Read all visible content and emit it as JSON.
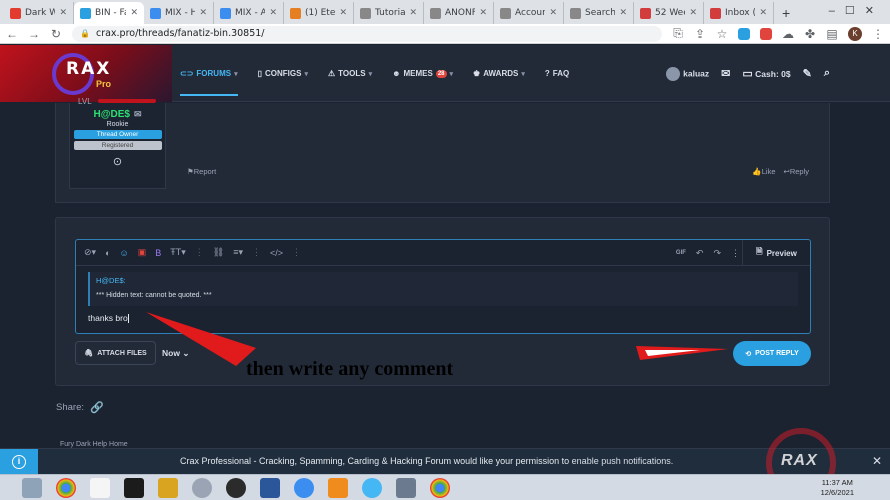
{
  "browser": {
    "tabs": [
      {
        "label": "Dark W",
        "color": "#e33b2e",
        "active": false
      },
      {
        "label": "BIN - Fa",
        "color": "#2aa0e0",
        "active": true
      },
      {
        "label": "MIX - H",
        "color": "#3c8df0",
        "active": false
      },
      {
        "label": "MIX - A",
        "color": "#3c8df0",
        "active": false
      },
      {
        "label": "(1) Eter",
        "color": "#e67e22",
        "active": false
      },
      {
        "label": "Tutoria",
        "color": "#888888",
        "active": false
      },
      {
        "label": "ANONF",
        "color": "#888888",
        "active": false
      },
      {
        "label": "Accoun",
        "color": "#888888",
        "active": false
      },
      {
        "label": "Search",
        "color": "#888888",
        "active": false
      },
      {
        "label": "52 Wee",
        "color": "#d23c3c",
        "active": false
      },
      {
        "label": "Inbox (",
        "color": "#d23c3c",
        "active": false
      }
    ],
    "new_tab": "+",
    "url": "crax.pro/threads/fanatiz-bin.30851/",
    "profile_initial": "K"
  },
  "header": {
    "brand_name": "RAX",
    "brand_sub": "Pro",
    "nav": [
      {
        "label": "FORUMS",
        "icon": "forums-icon",
        "active": true,
        "caret": true
      },
      {
        "label": "CONFIGS",
        "icon": "configs-icon",
        "active": false,
        "caret": true
      },
      {
        "label": "TOOLS",
        "icon": "tools-icon",
        "active": false,
        "caret": true
      },
      {
        "label": "MEMES",
        "icon": "memes-icon",
        "active": false,
        "caret": true,
        "badge": "28"
      },
      {
        "label": "AWARDS",
        "icon": "awards-icon",
        "active": false,
        "caret": true
      },
      {
        "label": "FAQ",
        "icon": "faq-icon",
        "active": false,
        "caret": false
      }
    ],
    "username": "kaluaz",
    "cash": "Cash: 0$"
  },
  "post": {
    "author": "H@DE$",
    "rank": "Rookie",
    "tags": [
      "Thread Owner",
      "Registered"
    ],
    "report_label": "Report",
    "like_label": "Like",
    "reply_label": "Reply"
  },
  "reply": {
    "preview_label": "Preview",
    "gif_label": "GIF",
    "quote_author": "H@DE$:",
    "quote_text": "*** Hidden text: cannot be quoted. ***",
    "typed_text": "thanks bro",
    "attach_label": "ATTACH FILES",
    "now_label": "Now",
    "post_reply_label": "POST REPLY"
  },
  "annotation": {
    "text": "then write any comment",
    "arrow_color": "#e11b1b"
  },
  "share_label": "Share:",
  "footer_peek": "Fury Dark    Help    Home",
  "push": {
    "message": "Crax Professional - Cracking, Spamming, Carding & Hacking Forum would like your permission to",
    "link": "enable push notifications."
  },
  "watermark": "RAX",
  "clock": {
    "time": "11:37 AM",
    "date": "12/6/2021"
  }
}
